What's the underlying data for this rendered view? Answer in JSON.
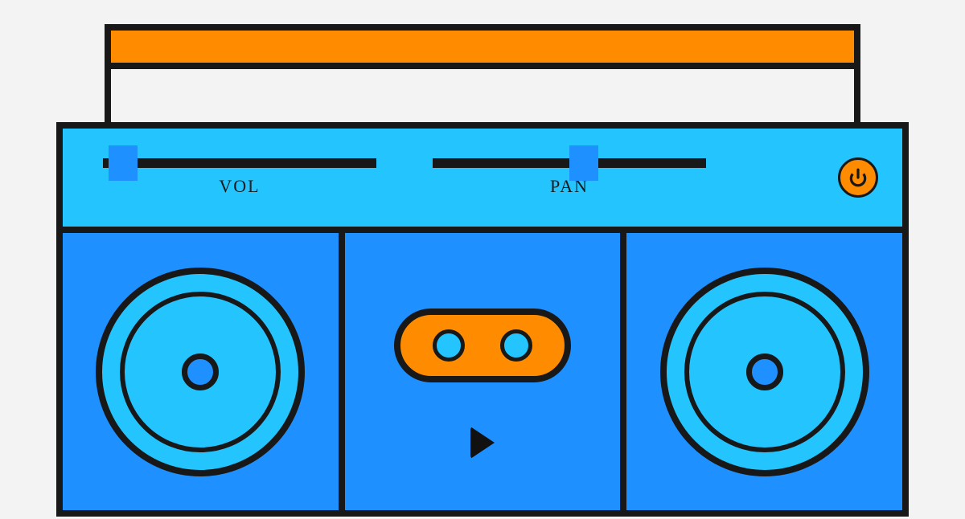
{
  "controls": {
    "volume": {
      "label": "VOL",
      "value_percent": 5
    },
    "pan": {
      "label": "PAN",
      "value_percent": 52
    }
  },
  "icons": {
    "power": "power-icon",
    "play": "play-icon"
  },
  "colors": {
    "orange": "#ff8c00",
    "blue": "#1e90ff",
    "cyan": "#24c4ff",
    "outline": "#181818"
  }
}
